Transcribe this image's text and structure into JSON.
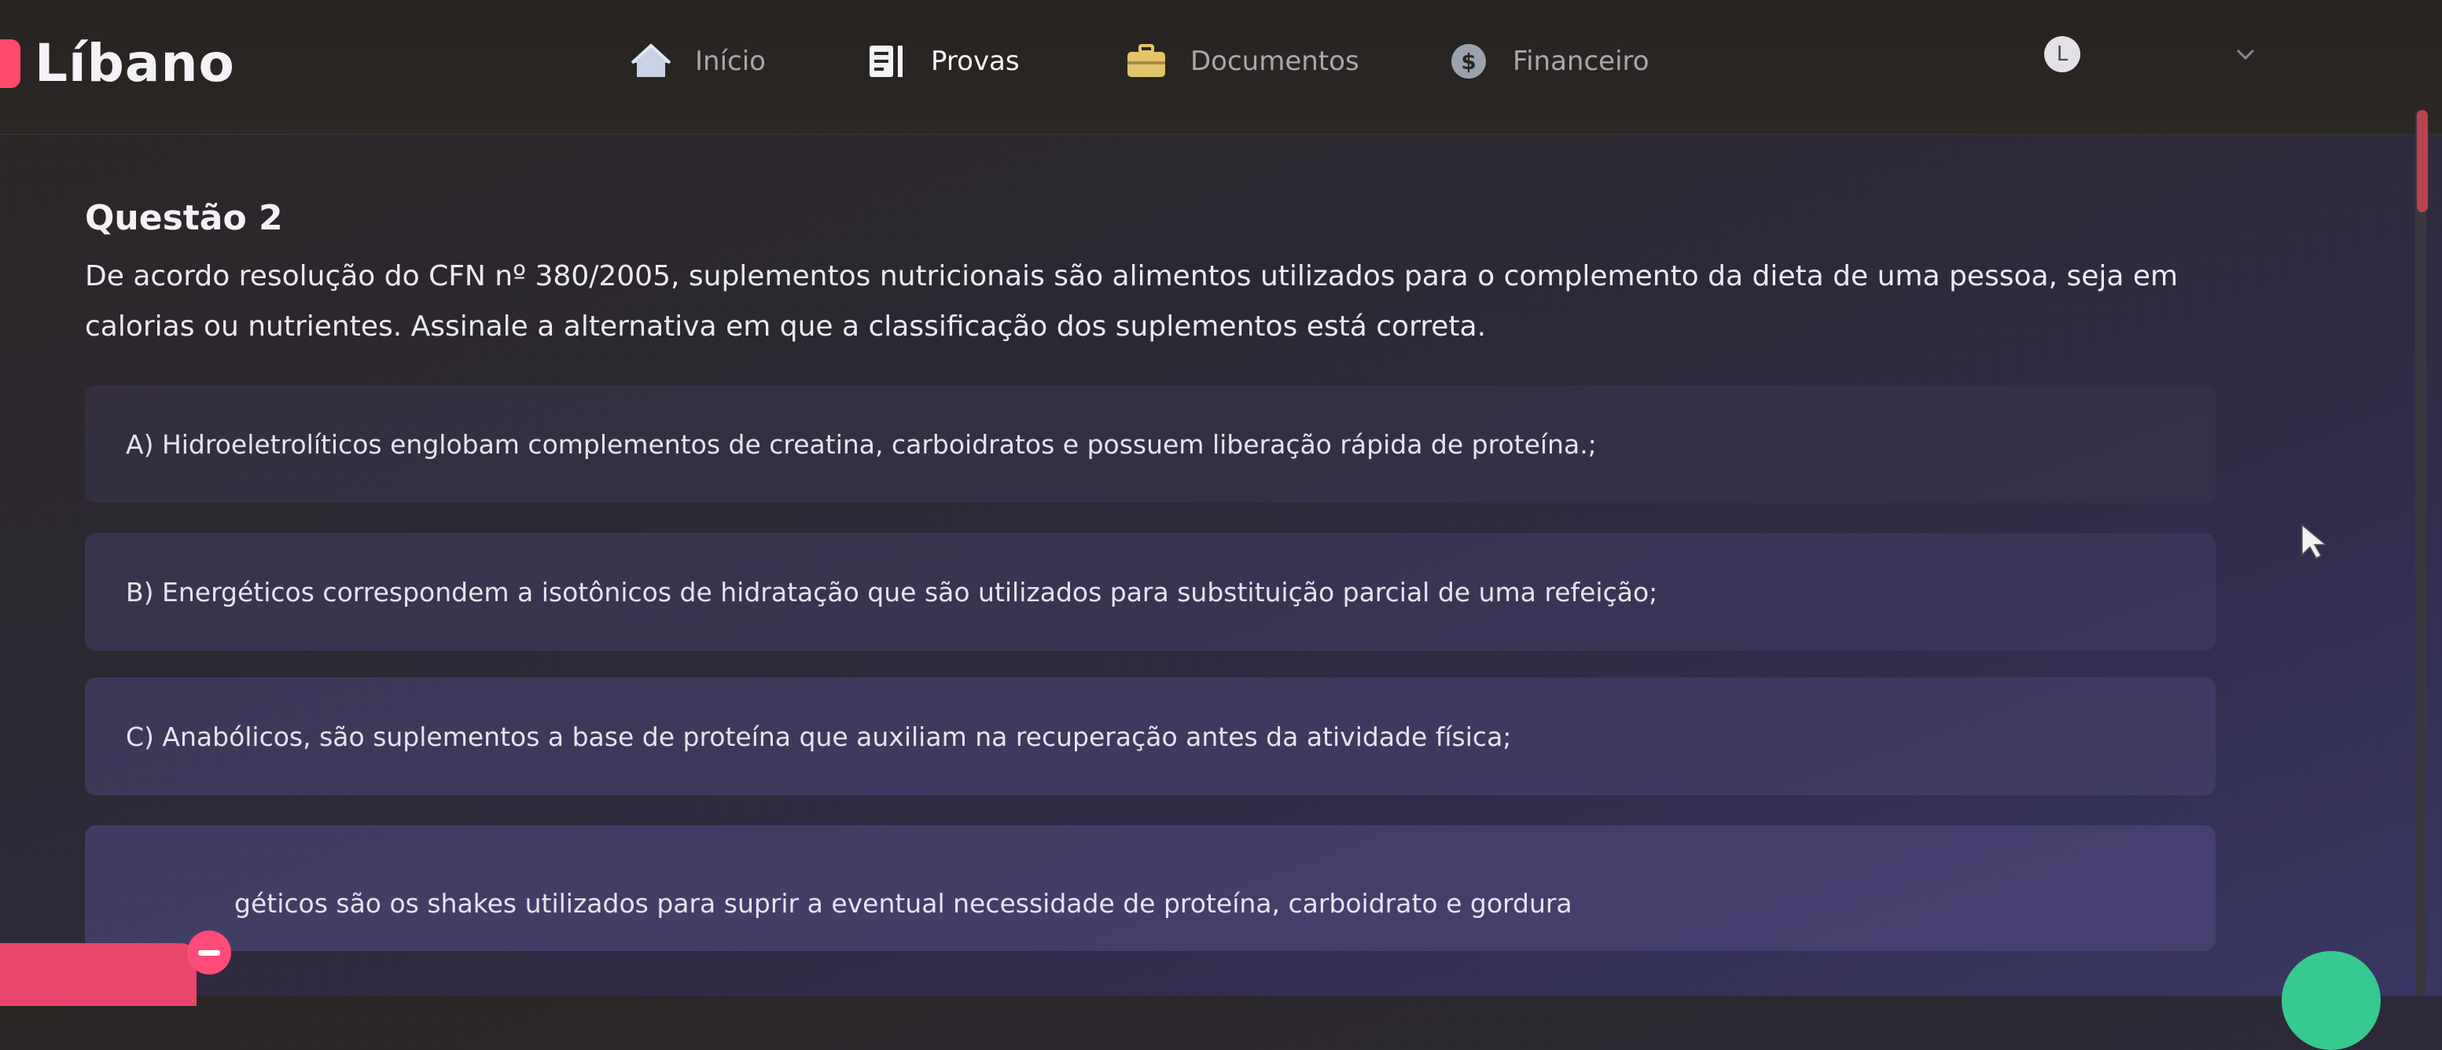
{
  "brand": {
    "name": "Líbano",
    "accent": "#ff4a6a"
  },
  "nav": {
    "items": [
      {
        "label": "Início",
        "icon": "home-icon",
        "active": false
      },
      {
        "label": "Provas",
        "icon": "exam-icon",
        "active": true
      },
      {
        "label": "Documentos",
        "icon": "briefcase-icon",
        "active": false
      },
      {
        "label": "Financeiro",
        "icon": "dollar-coin-icon",
        "active": false
      }
    ]
  },
  "user": {
    "initial": "L"
  },
  "question": {
    "title": "Questão 2",
    "text": "De acordo  resolução do CFN nº 380/2005, suplementos nutricionais são alimentos utilizados para o complemento da dieta de uma pessoa, seja em calorias ou nutrientes. Assinale a  alternativa em que a classificação dos suplementos está correta."
  },
  "alternatives": [
    {
      "text": "A) Hidroeletrolíticos englobam complementos de creatina, carboidratos e possuem liberação rápida de proteína.;"
    },
    {
      "text": "B) Energéticos correspondem a isotônicos de hidratação que são utilizados para substituição parcial de uma refeição;"
    },
    {
      "text": "C) Anabólicos, são suplementos a base de proteína que auxiliam na recuperação antes da atividade física;"
    },
    {
      "text": "géticos são os shakes utilizados para suprir a eventual necessidade de proteína, carboidrato e gordura"
    }
  ],
  "colors": {
    "scrollbar_thumb": "#b9434e",
    "fab": "#36c990",
    "pink_tab": "#e8466a"
  }
}
